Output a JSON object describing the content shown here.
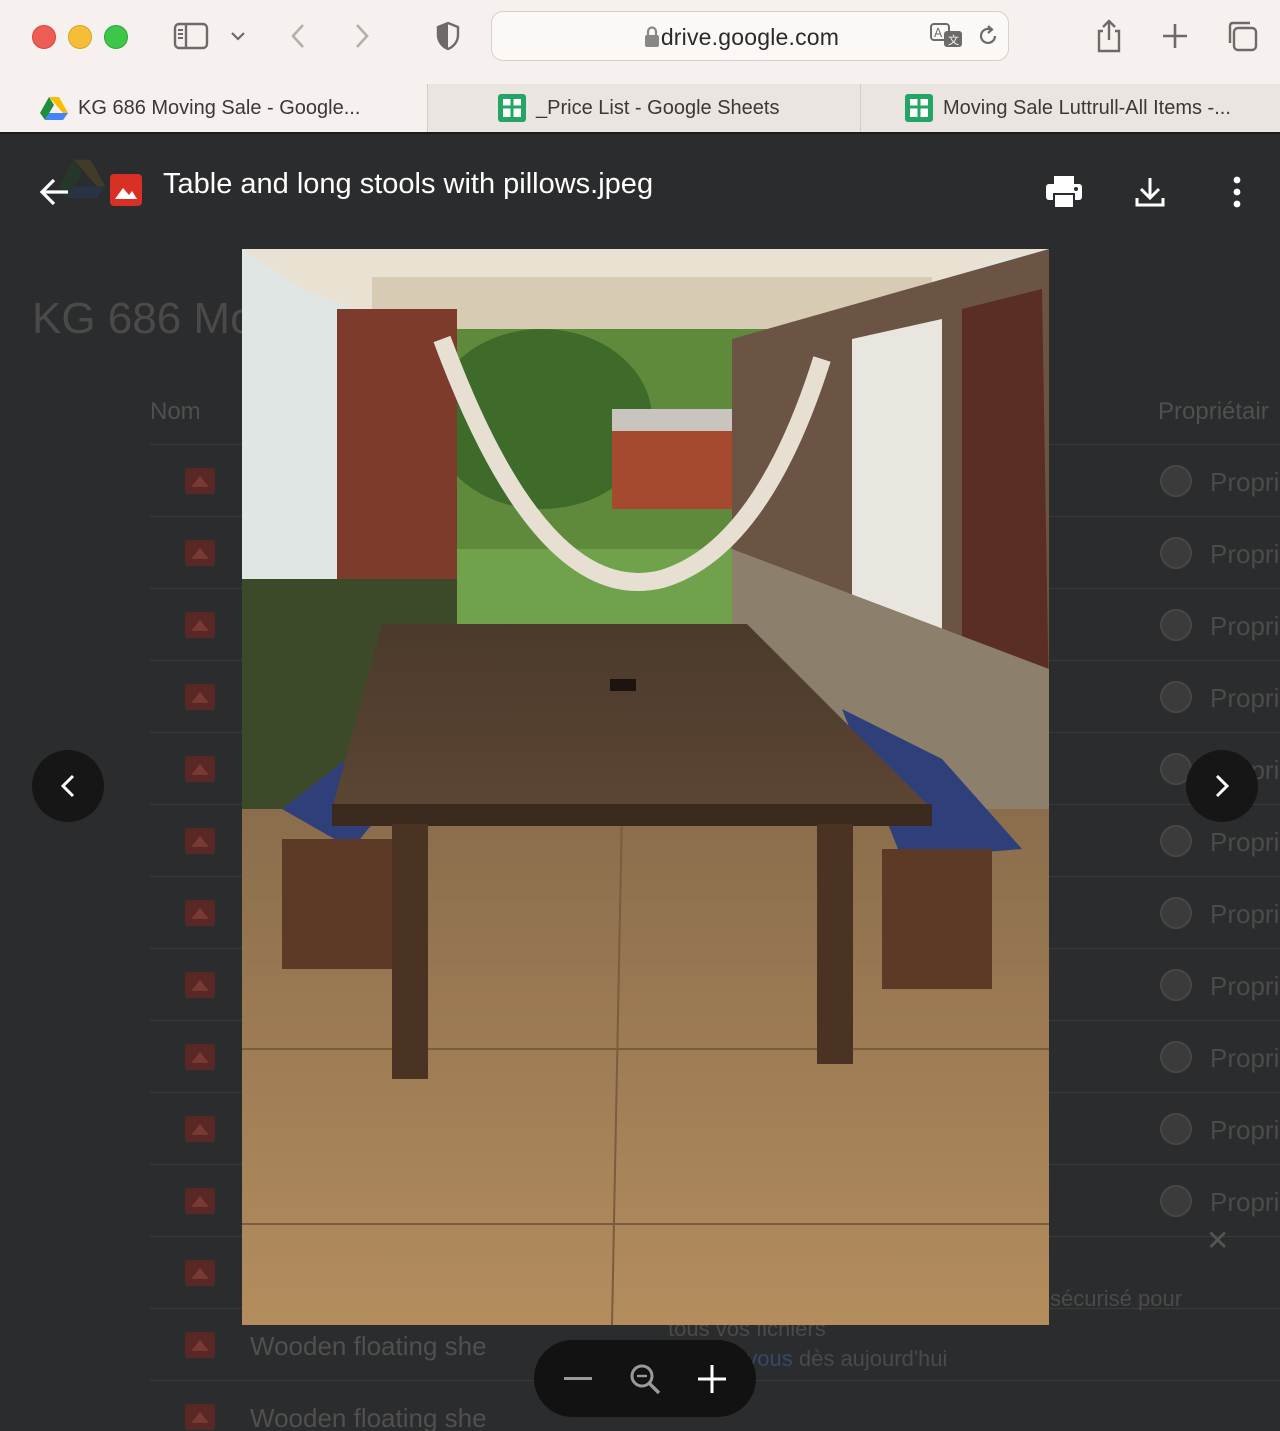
{
  "browser": {
    "address": "drive.google.com",
    "tabs": [
      {
        "label": "KG 686 Moving Sale - Google...",
        "icon": "google-drive-icon",
        "active": true
      },
      {
        "label": "_Price List - Google Sheets",
        "icon": "google-sheets-icon",
        "active": false
      },
      {
        "label": "Moving Sale Luttrull-All Items -...",
        "icon": "google-sheets-icon",
        "active": false
      }
    ]
  },
  "drive": {
    "page_title": "KG 686 Mo",
    "col_name": "Nom",
    "col_owner": "Propriétair",
    "rows": [
      {
        "name": "",
        "owner": "Propri"
      },
      {
        "name": "",
        "owner": "Propri"
      },
      {
        "name": "",
        "owner": "Propri"
      },
      {
        "name": "",
        "owner": "Propri"
      },
      {
        "name": "",
        "owner": "Propri"
      },
      {
        "name": "",
        "owner": "Propri"
      },
      {
        "name": "",
        "owner": "Propri"
      },
      {
        "name": "",
        "owner": "Propri"
      },
      {
        "name": "",
        "owner": "Propri"
      },
      {
        "name": "",
        "owner": "Propri"
      },
      {
        "name": "",
        "owner": "Propri"
      },
      {
        "name": "",
        "owner": ""
      },
      {
        "name": "Wooden floating she",
        "owner": ""
      },
      {
        "name": "Wooden floating she",
        "owner": ""
      }
    ],
    "promo_line1": "sécurisé pour",
    "promo_line2": "tous vos fichiers",
    "promo_line3_link": "Lancez-vous",
    "promo_line3_rest": " dès aujourd'hui"
  },
  "viewer": {
    "file_title": "Table and long stools with pillows.jpeg",
    "icons": {
      "back": "arrow-back-icon",
      "file_type": "image-file-icon",
      "print": "print-icon",
      "download": "download-icon",
      "more": "more-vert-icon",
      "prev": "chevron-left-icon",
      "next": "chevron-right-icon",
      "zoom_out": "minus-icon",
      "zoom_reset": "magnifier-icon",
      "zoom_in": "plus-icon"
    }
  }
}
